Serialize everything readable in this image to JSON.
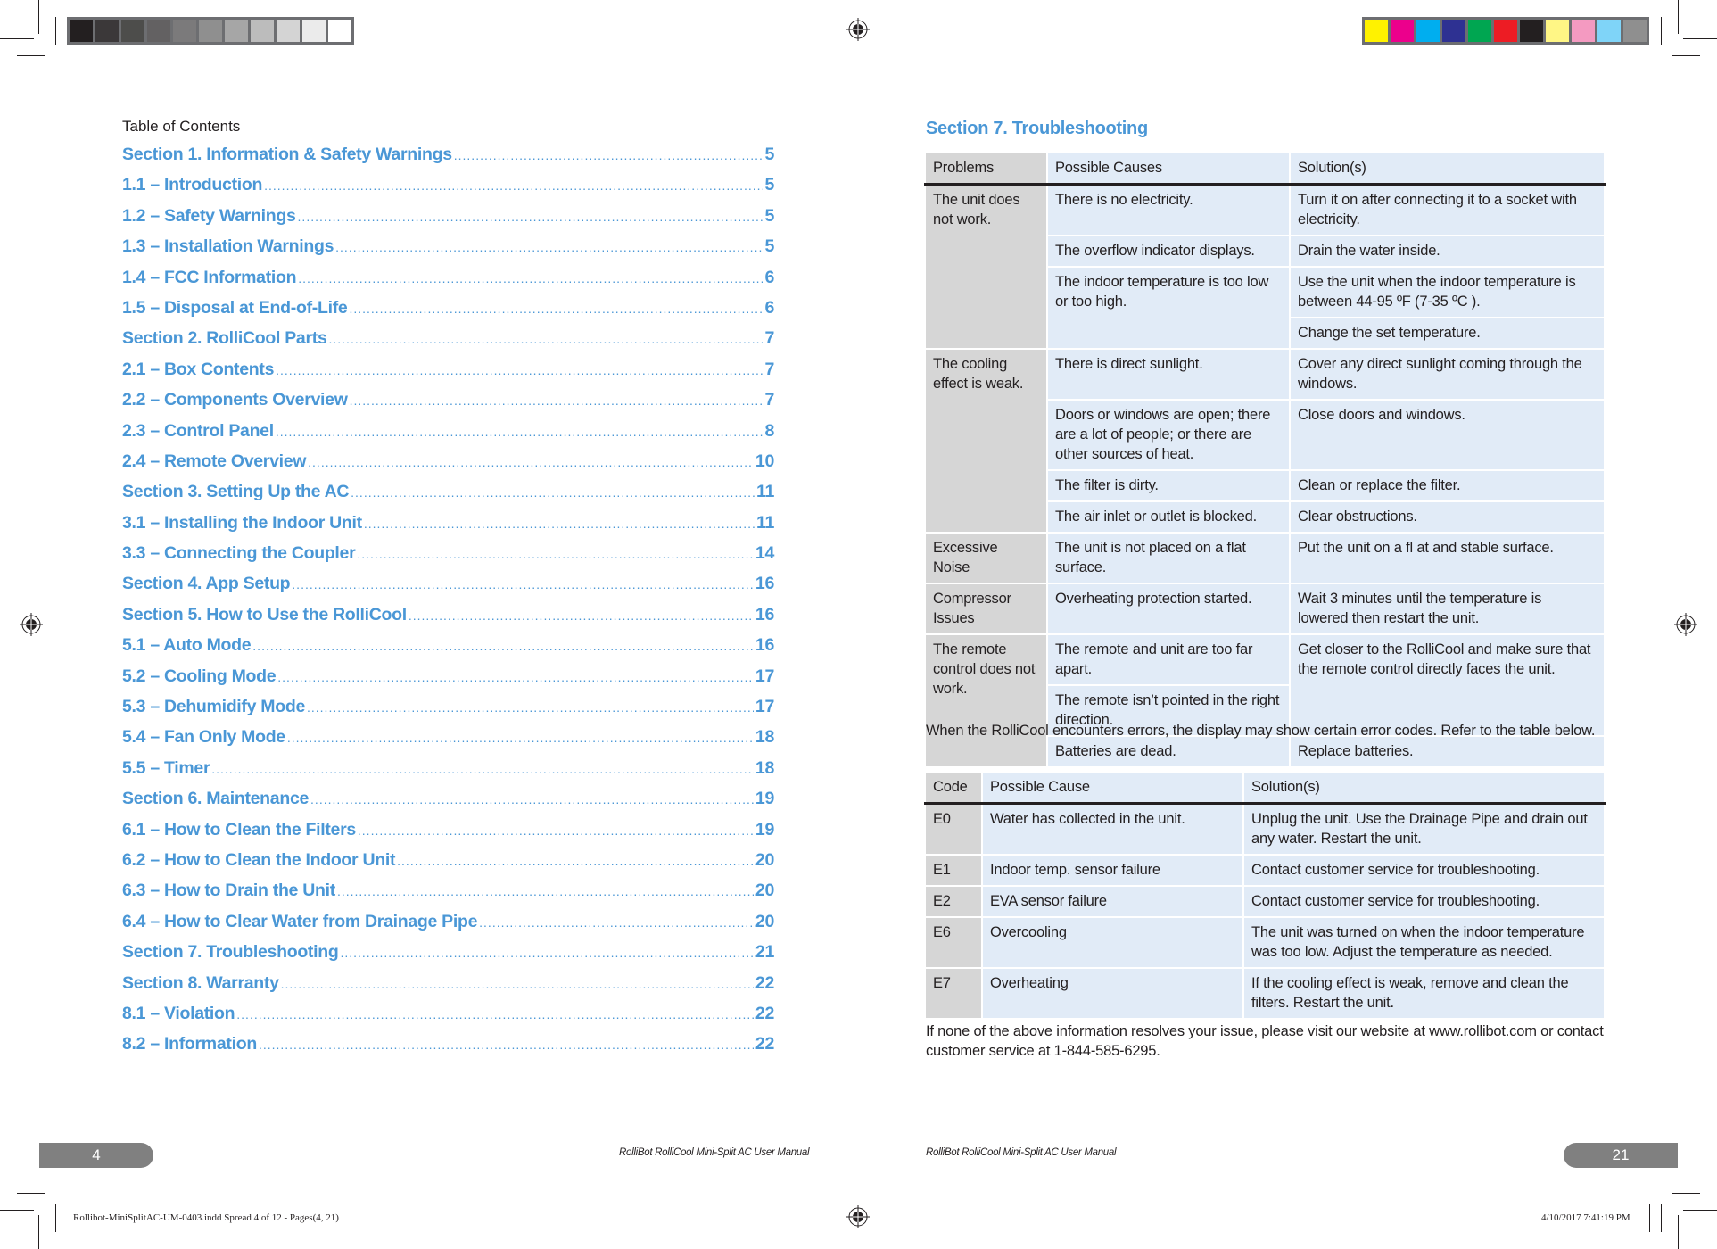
{
  "print_marks": {
    "gray_swatches": [
      "#231f20",
      "#3b3839",
      "#4d4d4b",
      "#636162",
      "#7b7a7b",
      "#8f8f8f",
      "#a6a6a6",
      "#bcbcbc",
      "#d4d4d4",
      "#ebebeb",
      "#ffffff"
    ],
    "color_swatches": [
      "#fff200",
      "#ec008c",
      "#00aeef",
      "#2e3192",
      "#00a651",
      "#ed1c24",
      "#231f20",
      "#fff685",
      "#f49ac1",
      "#7fd4f8",
      "#8f8f8f"
    ]
  },
  "left_page": {
    "toc_title": "Table of Contents",
    "toc": [
      {
        "label": "Section 1. Information & Safety Warnings",
        "page": "5"
      },
      {
        "label": "1.1 – Introduction",
        "page": "5"
      },
      {
        "label": "1.2 – Safety Warnings",
        "page": "5"
      },
      {
        "label": "1.3 – Installation Warnings",
        "page": "5"
      },
      {
        "label": "1.4 – FCC Information",
        "page": "6"
      },
      {
        "label": "1.5 – Disposal at End-of-Life",
        "page": "6"
      },
      {
        "label": "Section 2. RolliCool Parts",
        "page": "7"
      },
      {
        "label": "2.1 – Box Contents",
        "page": "7"
      },
      {
        "label": "2.2 – Components Overview",
        "page": "7"
      },
      {
        "label": "2.3 – Control Panel",
        "page": "8"
      },
      {
        "label": "2.4 – Remote Overview",
        "page": "10"
      },
      {
        "label": "Section 3. Setting Up the AC",
        "page": "11"
      },
      {
        "label": "3.1 – Installing the Indoor Unit",
        "page": "11"
      },
      {
        "label": "3.3 – Connecting the Coupler",
        "page": "14"
      },
      {
        "label": "Section 4. App Setup",
        "page": "16"
      },
      {
        "label": "Section 5. How to Use the RolliCool",
        "page": "16"
      },
      {
        "label": "5.1 – Auto Mode",
        "page": "16"
      },
      {
        "label": "5.2 – Cooling Mode",
        "page": "17"
      },
      {
        "label": "5.3 – Dehumidify Mode",
        "page": "17"
      },
      {
        "label": "5.4 – Fan Only Mode",
        "page": "18"
      },
      {
        "label": "5.5 – Timer",
        "page": "18"
      },
      {
        "label": "Section 6. Maintenance",
        "page": "19"
      },
      {
        "label": "6.1 – How to Clean the Filters",
        "page": "19"
      },
      {
        "label": "6.2 – How to Clean the Indoor Unit",
        "page": "20"
      },
      {
        "label": "6.3 – How to Drain the Unit",
        "page": "20"
      },
      {
        "label": "6.4 – How to Clear Water from Drainage Pipe",
        "page": "20"
      },
      {
        "label": "Section 7. Troubleshooting",
        "page": "21"
      },
      {
        "label": "Section 8. Warranty",
        "page": "22"
      },
      {
        "label": "8.1 – Violation",
        "page": "22"
      },
      {
        "label": "8.2 – Information",
        "page": "22"
      }
    ],
    "page_number": "4",
    "running_footer": "RolliBot RolliCool Mini-Split AC User Manual"
  },
  "right_page": {
    "section_title": "Section 7. Troubleshooting",
    "trouble_table": {
      "headers": [
        "Problems",
        "Possible Causes",
        "Solution(s)"
      ],
      "problems": [
        "The unit does not work.",
        "The cooling effect is weak.",
        "Excessive Noise",
        "Compressor Issues",
        "The remote control does not work."
      ],
      "rows": [
        {
          "cause": "There is no electricity.",
          "solution": "Turn it on after connecting it to a socket with electricity."
        },
        {
          "cause": "The overflow indicator displays.",
          "solution": "Drain the water inside."
        },
        {
          "cause": "The indoor temperature is too low or too high.",
          "solution": "Use the unit when the indoor temperature is between 44-95 ºF (7-35 ºC )."
        },
        {
          "cause": "",
          "solution": "Change the set temperature."
        },
        {
          "cause": "There is direct sunlight.",
          "solution": "Cover any direct sunlight coming through the windows."
        },
        {
          "cause": "Doors or windows are open; there are a lot of people; or there are other sources of heat.",
          "solution": "Close doors and windows."
        },
        {
          "cause": "The filter is dirty.",
          "solution": "Clean or replace the filter."
        },
        {
          "cause": "The air inlet or outlet is blocked.",
          "solution": "Clear obstructions."
        },
        {
          "cause": "The unit is not placed on a flat surface.",
          "solution": "Put the unit on a fl at and stable surface."
        },
        {
          "cause": "Overheating protection started.",
          "solution": "Wait 3 minutes until the temperature is lowered then restart the unit."
        },
        {
          "cause": "The remote and unit are too far apart.",
          "solution": "Get closer to the RolliCool and make sure that the remote control directly faces the unit."
        },
        {
          "cause": "The remote isn’t pointed in the right direction.",
          "solution": ""
        },
        {
          "cause": "Batteries are dead.",
          "solution": "Replace batteries."
        }
      ]
    },
    "error_intro": "When the RolliCool encounters errors, the display may show certain error codes. Refer to the table below.",
    "error_table": {
      "headers": [
        "Code",
        "Possible Cause",
        "Solution(s)"
      ],
      "rows": [
        {
          "code": "E0",
          "cause": "Water has collected in the unit.",
          "solution": "Unplug the unit. Use the Drainage Pipe and drain out any water. Restart the unit."
        },
        {
          "code": "E1",
          "cause": "Indoor temp. sensor failure",
          "solution": "Contact customer service for troubleshooting."
        },
        {
          "code": "E2",
          "cause": "EVA sensor failure",
          "solution": "Contact customer service for troubleshooting."
        },
        {
          "code": "E6",
          "cause": "Overcooling",
          "solution": "The unit was turned on when the indoor temperature was too low. Adjust the temperature as needed."
        },
        {
          "code": "E7",
          "cause": "Overheating",
          "solution": "If the cooling effect is weak, remove and clean the filters. Restart the unit."
        }
      ]
    },
    "closing_note": "If none of the above information resolves your issue, please visit our website at www.rollibot.com or contact customer service at 1-844-585-6295.",
    "page_number": "21",
    "running_footer": "RolliBot RolliCool Mini-Split AC User Manual"
  },
  "slug": {
    "file_info": "Rollibot-MiniSplitAC-UM-0403.indd   Spread 4 of 12 - Pages(4, 21)",
    "timestamp": "4/10/2017   7:41:19 PM"
  }
}
